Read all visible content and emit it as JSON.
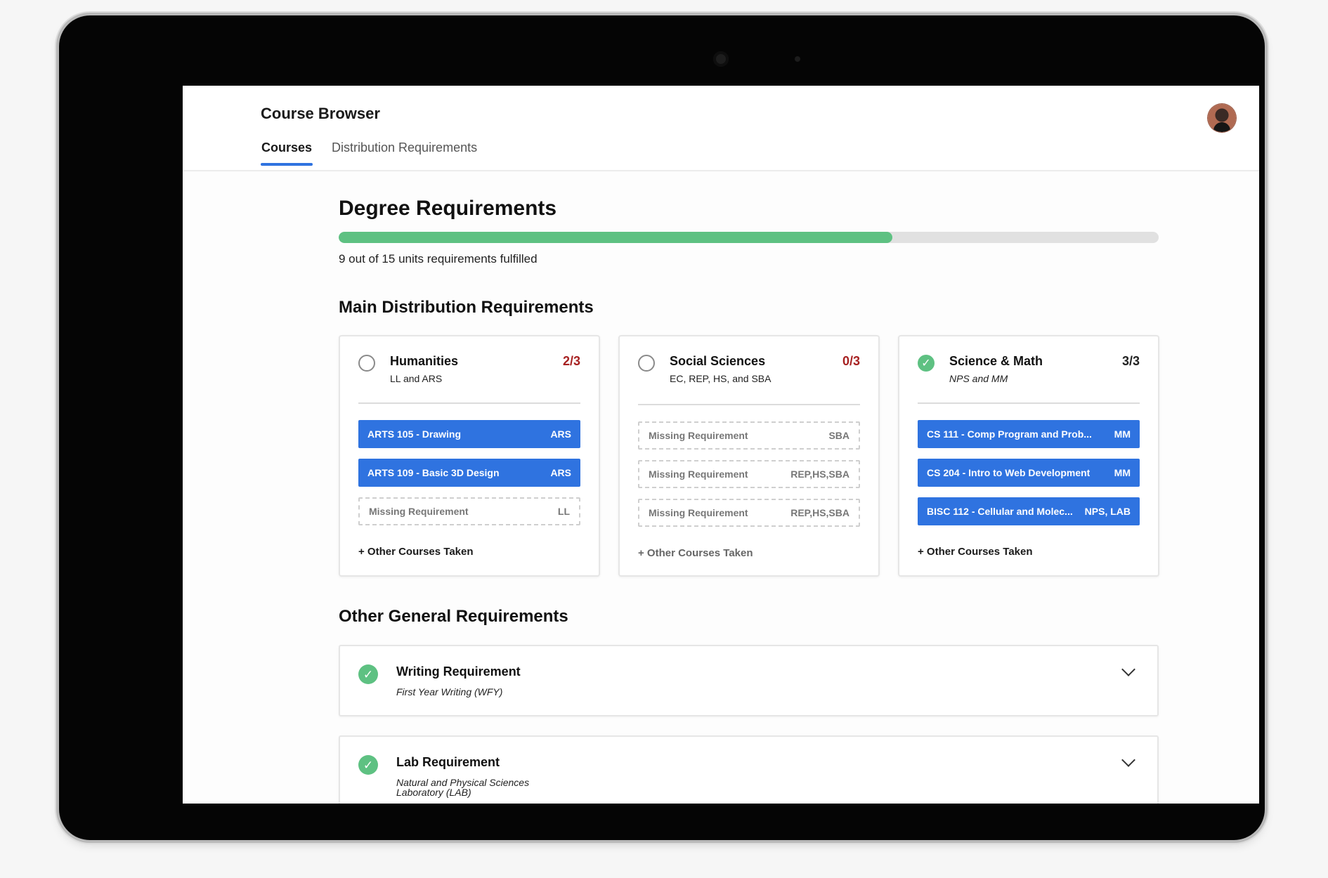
{
  "header": {
    "app_title": "Course Browser",
    "tabs": [
      {
        "label": "Courses",
        "active": true
      },
      {
        "label": "Distribution Requirements",
        "active": false
      }
    ]
  },
  "degree": {
    "title": "Degree Requirements",
    "progress_fraction": 0.675,
    "progress_text": "9 out of 15 units requirements fulfilled"
  },
  "main_section_title": "Main Distribution Requirements",
  "distribution_cards": [
    {
      "name": "Humanities",
      "subtitle": "LL and ARS",
      "count": "2/3",
      "complete": false,
      "slots": [
        {
          "name": "ARTS 105 - Drawing",
          "code": "ARS",
          "filled": true
        },
        {
          "name": "ARTS 109 - Basic 3D Design",
          "code": "ARS",
          "filled": true
        },
        {
          "name": "Missing Requirement",
          "code": "LL",
          "filled": false
        }
      ],
      "other_link": "+ Other Courses Taken"
    },
    {
      "name": "Social Sciences",
      "subtitle": "EC, REP, HS, and SBA",
      "count": "0/3",
      "complete": false,
      "slots": [
        {
          "name": "Missing Requirement",
          "code": "SBA",
          "filled": false
        },
        {
          "name": "Missing Requirement",
          "code": "REP,HS,SBA",
          "filled": false
        },
        {
          "name": "Missing Requirement",
          "code": "REP,HS,SBA",
          "filled": false
        }
      ],
      "other_link": "+ Other Courses Taken"
    },
    {
      "name": "Science & Math",
      "subtitle": "NPS and MM",
      "count": "3/3",
      "complete": true,
      "slots": [
        {
          "name": "CS 111 -  Comp Program and Prob...",
          "code": "MM",
          "filled": true
        },
        {
          "name": "CS 204 - Intro to Web Development",
          "code": "MM",
          "filled": true
        },
        {
          "name": "BISC 112 - Cellular and Molec...",
          "code": "NPS, LAB",
          "filled": true
        }
      ],
      "other_link": "+ Other Courses Taken"
    }
  ],
  "other_section_title": "Other General Requirements",
  "other_requirements": [
    {
      "name": "Writing Requirement",
      "subtitle": "First Year Writing (WFY)",
      "complete": true
    },
    {
      "name": "Lab Requirement",
      "subtitle": "Natural and Physical Sciences Laboratory (LAB)",
      "complete": true
    }
  ],
  "icons": {
    "check": "✓",
    "chevron": "chevron-down-icon",
    "avatar": "user-avatar"
  },
  "colors": {
    "accent_blue": "#2f73e0",
    "progress_green": "#5ec182",
    "incomplete_count_red": "#a72121"
  }
}
